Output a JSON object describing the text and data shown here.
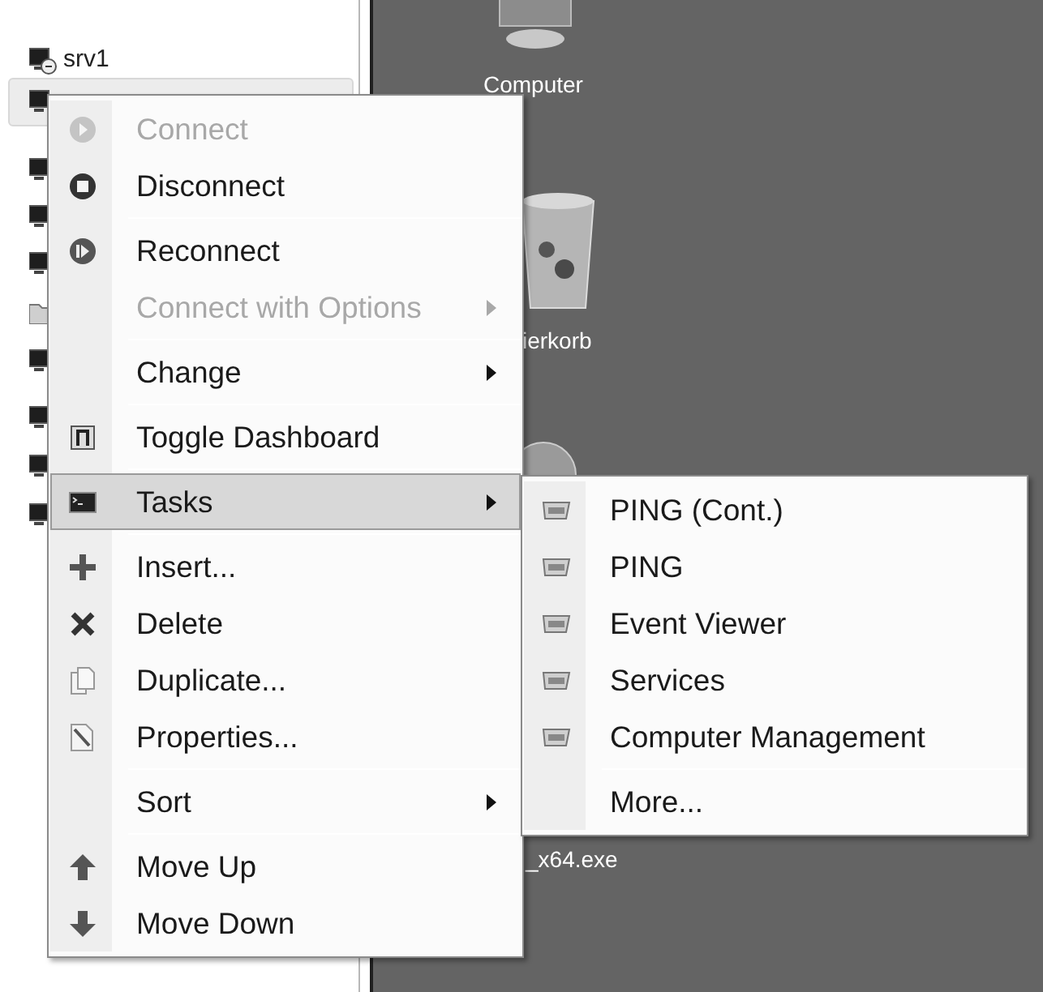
{
  "tree": {
    "items": [
      {
        "kind": "computer",
        "label": "srv1",
        "selected": false
      },
      {
        "kind": "computer",
        "selected": true
      },
      {
        "kind": "computer",
        "selected": false
      },
      {
        "kind": "computer",
        "selected": false
      },
      {
        "kind": "computer",
        "selected": false
      },
      {
        "kind": "folder",
        "selected": false
      },
      {
        "kind": "computer",
        "selected": false
      },
      {
        "kind": "computer",
        "selected": false
      },
      {
        "kind": "computer",
        "selected": false
      },
      {
        "kind": "computer",
        "selected": false
      }
    ]
  },
  "desktop": {
    "icons": [
      {
        "kind": "computer",
        "label": "Computer"
      },
      {
        "kind": "bin",
        "label": "ierkorb"
      },
      {
        "kind": "disc"
      },
      {
        "kind": "file",
        "label": "_x64.exe"
      }
    ]
  },
  "context_menu": {
    "items": [
      {
        "kind": "item",
        "label": "Connect",
        "disabled": true,
        "submenu": false,
        "selected": false
      },
      {
        "kind": "item",
        "label": "Disconnect",
        "disabled": false,
        "submenu": false,
        "selected": false
      },
      {
        "kind": "separator"
      },
      {
        "kind": "item",
        "label": "Reconnect",
        "disabled": false,
        "submenu": false,
        "selected": false
      },
      {
        "kind": "item",
        "label": "Connect with Options",
        "disabled": true,
        "submenu": true,
        "selected": false
      },
      {
        "kind": "separator"
      },
      {
        "kind": "item",
        "label": "Change",
        "disabled": false,
        "submenu": true,
        "selected": false
      },
      {
        "kind": "separator"
      },
      {
        "kind": "item",
        "label": "Toggle Dashboard",
        "disabled": false,
        "submenu": false,
        "selected": false
      },
      {
        "kind": "separator"
      },
      {
        "kind": "item",
        "label": "Tasks",
        "disabled": false,
        "submenu": true,
        "selected": true
      },
      {
        "kind": "separator"
      },
      {
        "kind": "item",
        "label": "Insert...",
        "disabled": false,
        "submenu": false,
        "selected": false
      },
      {
        "kind": "item",
        "label": "Delete",
        "disabled": false,
        "submenu": false,
        "selected": false
      },
      {
        "kind": "item",
        "label": "Duplicate...",
        "disabled": false,
        "submenu": false,
        "selected": false
      },
      {
        "kind": "item",
        "label": "Properties...",
        "disabled": false,
        "submenu": false,
        "selected": false
      },
      {
        "kind": "separator"
      },
      {
        "kind": "item",
        "label": "Sort",
        "disabled": false,
        "submenu": true,
        "selected": false
      },
      {
        "kind": "separator"
      },
      {
        "kind": "item",
        "label": "Move Up",
        "disabled": false,
        "submenu": false,
        "selected": false
      },
      {
        "kind": "item",
        "label": "Move Down",
        "disabled": false,
        "submenu": false,
        "selected": false
      }
    ]
  },
  "tasks_submenu": {
    "items": [
      {
        "kind": "task",
        "label": "PING (Cont.)"
      },
      {
        "kind": "task",
        "label": "PING"
      },
      {
        "kind": "task",
        "label": "Event Viewer"
      },
      {
        "kind": "task",
        "label": "Services"
      },
      {
        "kind": "task",
        "label": "Computer Management"
      },
      {
        "kind": "separator"
      },
      {
        "kind": "item",
        "label": "More..."
      }
    ]
  }
}
